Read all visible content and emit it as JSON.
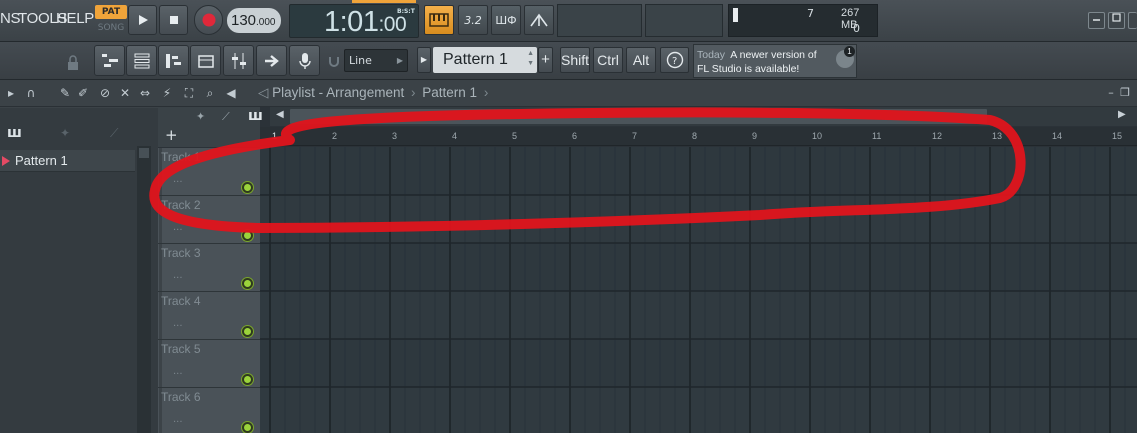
{
  "menu": {
    "items": [
      "NS",
      "TOOLS",
      "HELP"
    ]
  },
  "transport": {
    "pat_label": "PAT",
    "song_label": "SONG",
    "tempo": "130",
    "tempo_fraction": ".000",
    "time": "1:01",
    "time_ticks": ":00",
    "time_mode": "B:S:T"
  },
  "toolbar1": {
    "step_label": "3.2",
    "loop_label": "ШФ"
  },
  "stats": {
    "cpu_value": "7",
    "memory": "267 MB",
    "polyphony": "0"
  },
  "toolbar2": {
    "snap": "Line",
    "pattern": "Pattern 1",
    "shift": "Shift",
    "ctrl": "Ctrl",
    "alt": "Alt",
    "hint_today": "Today",
    "hint_line1": "A newer version of",
    "hint_line2": "FL Studio is available!",
    "hint_badge": "1"
  },
  "playlist": {
    "breadcrumb": [
      "Playlist - Arrangement",
      "Pattern 1"
    ],
    "pattern_item": "Pattern 1",
    "add_label": "+",
    "ruler": [
      "1",
      "2",
      "3",
      "4",
      "5",
      "6",
      "7",
      "8",
      "9",
      "10",
      "11",
      "12",
      "13",
      "14",
      "15"
    ],
    "tracks": [
      {
        "name": "Track 1",
        "dots": "..."
      },
      {
        "name": "Track 2",
        "dots": "..."
      },
      {
        "name": "Track 3",
        "dots": "..."
      },
      {
        "name": "Track 4",
        "dots": "..."
      },
      {
        "name": "Track 5",
        "dots": "..."
      },
      {
        "name": "Track 6",
        "dots": "..."
      }
    ]
  },
  "colors": {
    "accent_orange": "#f0a43a",
    "record_red": "#e0283a",
    "led_green": "#9bd33b",
    "annotation_red": "#e0141c"
  }
}
